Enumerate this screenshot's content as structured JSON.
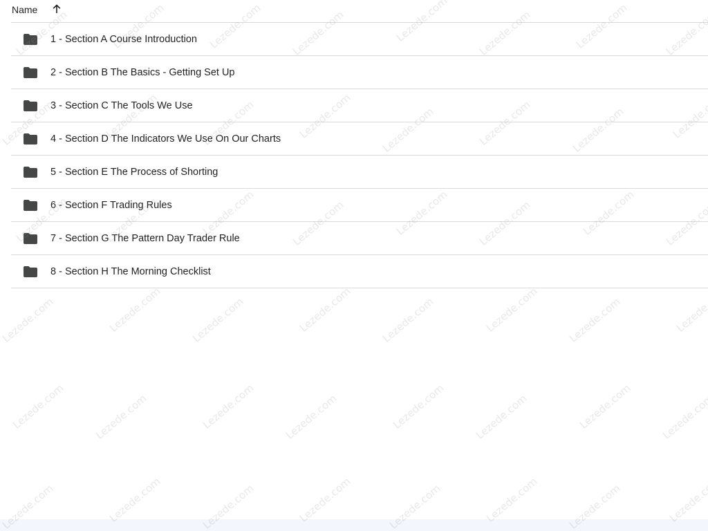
{
  "header": {
    "name_label": "Name",
    "sort_icon": "arrow-up-icon"
  },
  "folders": [
    {
      "label": "1 - Section A Course Introduction",
      "icon": "folder-icon"
    },
    {
      "label": "2 - Section B The Basics - Getting Set Up",
      "icon": "folder-icon"
    },
    {
      "label": "3 - Section C The Tools We Use",
      "icon": "folder-icon"
    },
    {
      "label": "4 - Section D The Indicators We Use On Our Charts",
      "icon": "folder-icon"
    },
    {
      "label": "5 - Section E The Process of Shorting",
      "icon": "folder-icon"
    },
    {
      "label": "6 - Section F Trading Rules",
      "icon": "folder-icon"
    },
    {
      "label": "7 - Section G The Pattern Day Trader Rule",
      "icon": "folder-icon"
    },
    {
      "label": "8 - Section H The Morning Checklist",
      "icon": "folder-icon"
    }
  ],
  "watermark": {
    "text": "Lezede.com"
  },
  "colors": {
    "folder": "#444746",
    "text": "#1f1f1f",
    "divider": "#dadada",
    "bottom_strip": "#f3f6fc"
  }
}
